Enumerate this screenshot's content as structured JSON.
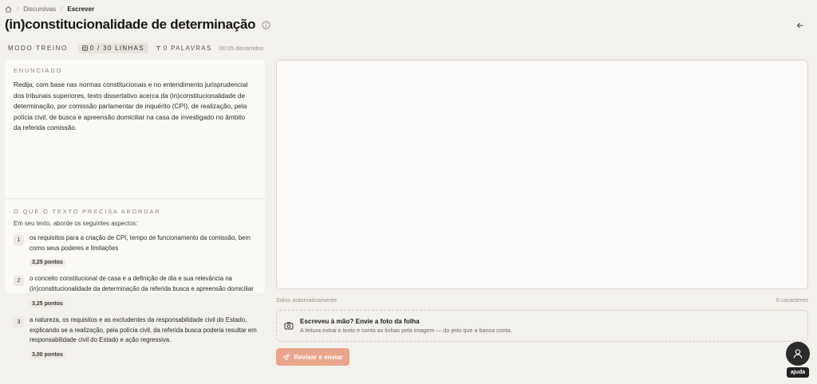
{
  "breadcrumb": {
    "items": [
      "Discursivas",
      "Escrever"
    ]
  },
  "title": "(in)constitucionalidade de determinação",
  "meta": {
    "mode": "MODO TREINO",
    "lines": "0 / 30 LINHAS",
    "words": "0 PALAVRAS",
    "elapsed": "00:05 decorridos"
  },
  "enunciado": {
    "heading": "ENUNCIADO",
    "text": "Redija, com base nas normas constitucionais e no entendimento jurisprudencial dos tribunais superiores, texto dissertativo acerca da (in)constitucionalidade de determinação, por comissão parlamentar de inquérito (CPI), de realização, pela polícia civil, de busca e apreensão domiciliar na casa de investigado no âmbito da referida comissão."
  },
  "aspects": {
    "heading": "O QUE O TEXTO PRECISA ABORDAR",
    "intro": "Em seu texto, aborde os seguintes aspectos:",
    "items": [
      {
        "num": "1",
        "text": "os requisitos para a criação de CPI, tempo de funcionamento da comissão, bem como seus poderes e limitações",
        "points": "3,25 pontos"
      },
      {
        "num": "2",
        "text": "o conceito constitucional de casa e a definição de dia e sua relevância na (in)constitucionalidade da determinação da referida busca e apreensão domiciliar",
        "points": "3,25 pontos"
      },
      {
        "num": "3",
        "text": "a natureza, os requisitos e as excludentes da responsabilidade civil do Estado, explicando se a realização, pela polícia civil, da referida busca poderia resultar em responsabilidade civil do Estado e ação regressiva.",
        "points": "3,00 pontos"
      }
    ]
  },
  "editor": {
    "value": ""
  },
  "status": {
    "saved": "Salvo automaticamente",
    "chars": "0 caracteres"
  },
  "upload": {
    "title": "Escreveu à mão? Envie a foto da folha",
    "subtitle": "A leitura extrai o texto e conta as linhas pela imagem — do jeito que a banca conta."
  },
  "submit_label": "Revisar e enviar",
  "help_label": "ajuda",
  "colors": {
    "accent": "#e9a58b",
    "background": "#f3f1ec",
    "card": "#fbfaf7",
    "fab": "#2b2b2b"
  }
}
